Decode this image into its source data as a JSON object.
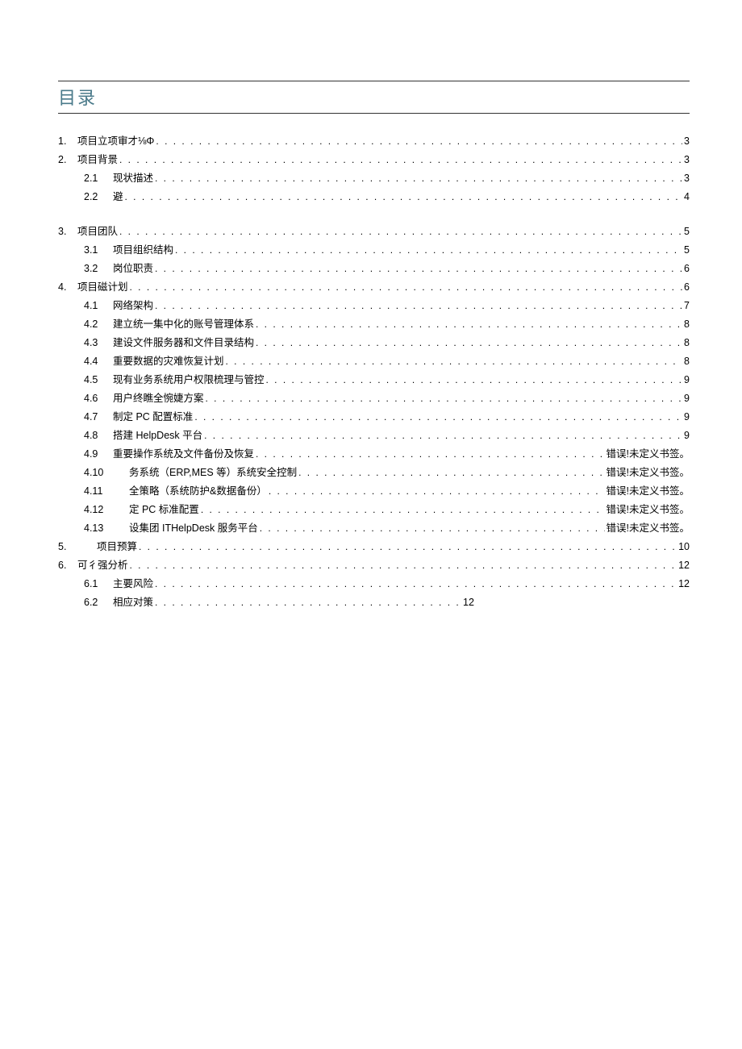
{
  "title": "目录",
  "toc": {
    "s1": {
      "num": "1.",
      "label": "项目立项审才⅛Φ",
      "page": "3"
    },
    "s2": {
      "num": "2.",
      "label": "项目背景",
      "page": "3"
    },
    "s2_1": {
      "num": "2.1",
      "label": "现状描述",
      "page": "3"
    },
    "s2_2": {
      "num": "2.2",
      "label": "避",
      "page": "4"
    },
    "s3": {
      "num": "3.",
      "label": "项目团队",
      "page": "5"
    },
    "s3_1": {
      "num": "3.1",
      "label": "项目组织结构",
      "page": "5"
    },
    "s3_2": {
      "num": "3.2",
      "label": "岗位职责",
      "page": "6"
    },
    "s4": {
      "num": "4.",
      "label": "项目磁计划",
      "page": "6"
    },
    "s4_1": {
      "num": "4.1",
      "label": "网络架构",
      "page": "7"
    },
    "s4_2": {
      "num": "4.2",
      "label": "建立统一集中化的账号管理体系",
      "page": "8"
    },
    "s4_3": {
      "num": "4.3",
      "label": "建设文件服务器和文件目录结构",
      "page": "8"
    },
    "s4_4": {
      "num": "4.4",
      "label": "重要数据的灾难恢复计划",
      "page": "8"
    },
    "s4_5": {
      "num": "4.5",
      "label": "现有业务系统用户权限梳理与管控",
      "page": "9"
    },
    "s4_6": {
      "num": "4.6",
      "label": "用户终瞧全惋婕方案",
      "page": "9"
    },
    "s4_7": {
      "num": "4.7",
      "label": "制定 PC 配置标准",
      "page": "9"
    },
    "s4_8": {
      "num": "4.8",
      "label": "搭建 HelpDesk 平台",
      "page": "9"
    },
    "s4_9": {
      "num": "4.9",
      "label": "重要操作系统及文件备份及恢复",
      "page": "错误!未定义书签。"
    },
    "s4_10": {
      "num": "4.10",
      "label": "务系统（ERP,MES 等）系统安全控制",
      "page": "错误!未定义书签。"
    },
    "s4_11": {
      "num": "4.11",
      "label": "全策略（系统防护&数据备份）",
      "page": "错误!未定义书签。"
    },
    "s4_12": {
      "num": "4.12",
      "label": "定 PC 标准配置",
      "page": "错误!未定义书签。"
    },
    "s4_13": {
      "num": "4.13",
      "label": "设集团 ITHelpDesk 服务平台",
      "page": "错误!未定义书签。"
    },
    "s5": {
      "num": "5.",
      "label": "项目预算",
      "page": "10"
    },
    "s6": {
      "num": "6.",
      "label": "可彳强分析",
      "page": "12"
    },
    "s6_1": {
      "num": "6.1",
      "label": "主要风险",
      "page": "12"
    },
    "s6_2": {
      "num": "6.2",
      "label": "相应对策",
      "page": "12"
    }
  }
}
